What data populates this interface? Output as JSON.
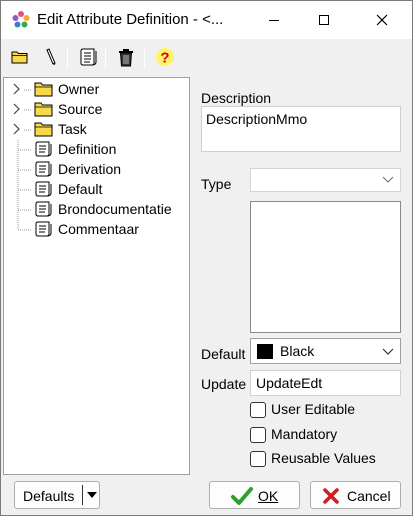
{
  "window": {
    "title": "Edit Attribute Definition - <...",
    "minimize_label": "Minimize",
    "maximize_label": "Maximize",
    "close_label": "Close"
  },
  "toolbar": {
    "buttons": [
      {
        "name": "open-folder-icon"
      },
      {
        "name": "edit-pencil-icon"
      },
      {
        "name": "scroll-document-icon"
      },
      {
        "name": "trash-icon"
      },
      {
        "name": "help-icon"
      }
    ]
  },
  "tree": {
    "items": [
      {
        "label": "Owner",
        "icon": "folder-icon",
        "expandable": true
      },
      {
        "label": "Source",
        "icon": "folder-icon",
        "expandable": true
      },
      {
        "label": "Task",
        "icon": "folder-icon",
        "expandable": true
      },
      {
        "label": "Definition",
        "icon": "scroll-icon",
        "expandable": false
      },
      {
        "label": "Derivation",
        "icon": "scroll-icon",
        "expandable": false
      },
      {
        "label": "Default",
        "icon": "scroll-icon",
        "expandable": false
      },
      {
        "label": "Brondocumentatie",
        "icon": "scroll-icon",
        "expandable": false
      },
      {
        "label": "Commentaar",
        "icon": "scroll-icon",
        "expandable": false
      }
    ]
  },
  "form": {
    "description_label": "Description",
    "description_value": "DescriptionMmo",
    "type_label": "Type",
    "type_value": "",
    "default_label": "Default",
    "default_color_name": "Black",
    "default_color_hex": "#000000",
    "update_label": "Update",
    "update_value": "UpdateEdt",
    "checkboxes": [
      {
        "label": "User Editable",
        "checked": false
      },
      {
        "label": "Mandatory",
        "checked": false
      },
      {
        "label": "Reusable Values",
        "checked": false
      }
    ]
  },
  "buttons": {
    "defaults_label": "Defaults",
    "ok_label": "OK",
    "cancel_label": "Cancel"
  },
  "colors": {
    "folder": "#f7d94c",
    "ok_check": "#2e9e2e",
    "cancel_x": "#cc1f1f",
    "help": "#d40000"
  }
}
